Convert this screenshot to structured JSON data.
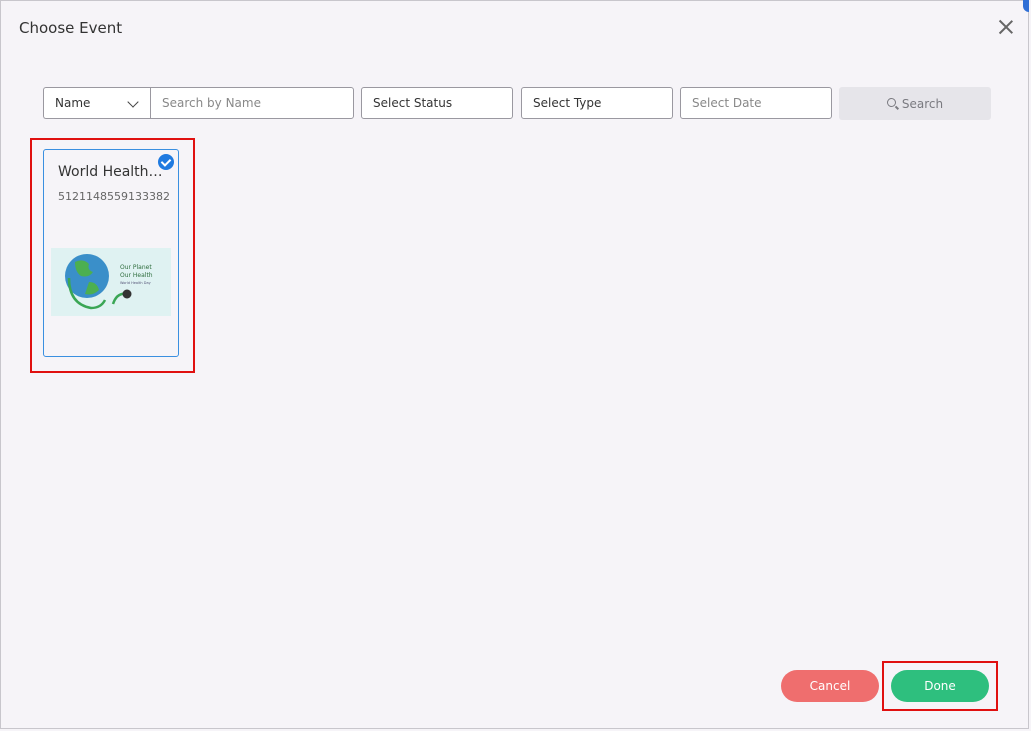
{
  "dialog": {
    "title": "Choose Event"
  },
  "filters": {
    "name_select": "Name",
    "search_placeholder": "Search by Name",
    "status_placeholder": "Select Status",
    "type_placeholder": "Select Type",
    "date_placeholder": "Select Date",
    "search_button": "Search"
  },
  "events": [
    {
      "title": "World Health Day",
      "id": "5121148559133382",
      "selected": true,
      "image_text": {
        "line1": "Our Planet",
        "line2": "Our Health",
        "line3": "World Health Day"
      }
    }
  ],
  "footer": {
    "cancel": "Cancel",
    "done": "Done"
  },
  "colors": {
    "selected_border": "#3a8fe0",
    "check": "#1f7ae0",
    "cancel": "#ef6e6e",
    "done": "#2ebf7e",
    "highlight": "#e01010"
  }
}
